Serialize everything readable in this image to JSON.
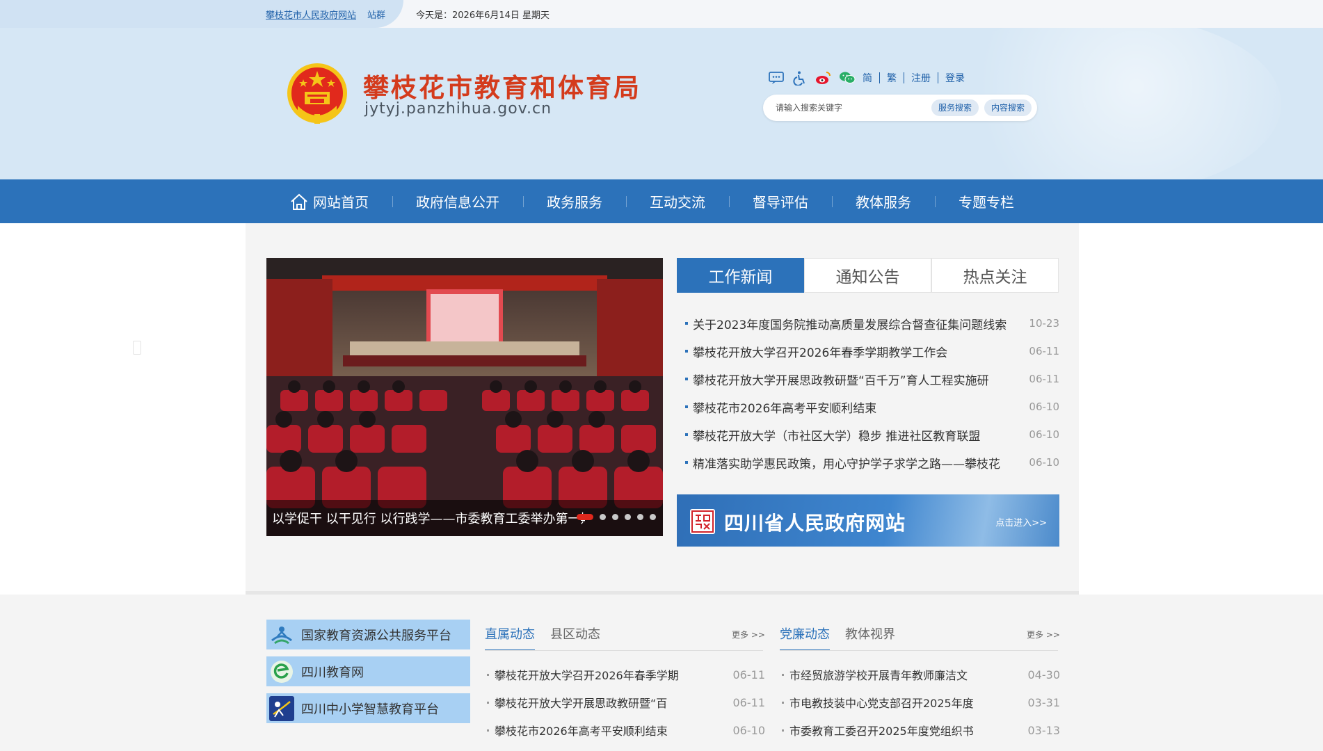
{
  "topbar": {
    "gov_link": "攀枝花市人民政府网站",
    "group_label": "站群",
    "date_text": "今天是：2026年6月14日 星期天"
  },
  "header": {
    "title": "攀枝花市教育和体育局",
    "domain": "jytyj.panzhihua.gov.cn",
    "tools": {
      "icons": [
        "message-icon",
        "accessibility-icon",
        "weibo-icon",
        "wechat-icon"
      ],
      "simplified": "简",
      "traditional": "繁",
      "register": "注册",
      "login": "登录"
    },
    "search": {
      "placeholder": "请输入搜索关键字",
      "service_btn": "服务搜索",
      "content_btn": "内容搜索"
    }
  },
  "nav": {
    "items": [
      {
        "label": "网站首页",
        "icon": "home-icon"
      },
      {
        "label": "政府信息公开"
      },
      {
        "label": "政务服务"
      },
      {
        "label": "互动交流"
      },
      {
        "label": "督导评估"
      },
      {
        "label": "教体服务"
      },
      {
        "label": "专题专栏"
      }
    ]
  },
  "carousel": {
    "caption": "以学促干 以干见行 以行践学——市委教育工委举办第一期",
    "dot_count": 6,
    "active_dot": 0
  },
  "news": {
    "tabs": [
      "工作新闻",
      "通知公告",
      "热点关注"
    ],
    "active_tab": 0,
    "items": [
      {
        "title": "关于2023年度国务院推动高质量发展综合督查征集问题线索",
        "date": "10-23"
      },
      {
        "title": "攀枝花开放大学召开2026年春季学期教学工作会",
        "date": "06-11"
      },
      {
        "title": "攀枝花开放大学开展思政教研暨“百千万”育人工程实施研",
        "date": "06-11"
      },
      {
        "title": "攀枝花市2026年高考平安顺利结束",
        "date": "06-10"
      },
      {
        "title": "攀枝花开放大学（市社区大学）稳步 推进社区教育联盟",
        "date": "06-10"
      },
      {
        "title": "精准落实助学惠民政策，用心守护学子求学之路——攀枝花",
        "date": "06-10"
      }
    ]
  },
  "banner": {
    "title": "四川省人民政府网站",
    "enter": "点击进入>>"
  },
  "platforms": [
    {
      "label": "国家教育资源公共服务平台",
      "icon": "national-edu-platform-icon"
    },
    {
      "label": "四川教育网",
      "icon": "sichuan-edu-icon"
    },
    {
      "label": "四川中小学智慧教育平台",
      "icon": "smart-edu-platform-icon"
    }
  ],
  "columns": [
    {
      "tabs": [
        "直属动态",
        "县区动态"
      ],
      "active_tab": 0,
      "more": "更多 >>",
      "items": [
        {
          "title": "攀枝花开放大学召开2026年春季学期",
          "date": "06-11"
        },
        {
          "title": "攀枝花开放大学开展思政教研暨“百",
          "date": "06-11"
        },
        {
          "title": "攀枝花市2026年高考平安顺利结束",
          "date": "06-10"
        }
      ]
    },
    {
      "tabs": [
        "党廉动态",
        "教体视界"
      ],
      "active_tab": 0,
      "more": "更多 >>",
      "items": [
        {
          "title": "市经贸旅游学校开展青年教师廉洁文",
          "date": "04-30"
        },
        {
          "title": "市电教技装中心党支部召开2025年度",
          "date": "03-31"
        },
        {
          "title": "市委教育工委召开2025年度党组织书",
          "date": "03-13"
        }
      ]
    }
  ],
  "colors": {
    "primary_blue": "#2c72ba",
    "title_red": "#d43b1c",
    "active_dot": "#e0281d"
  }
}
